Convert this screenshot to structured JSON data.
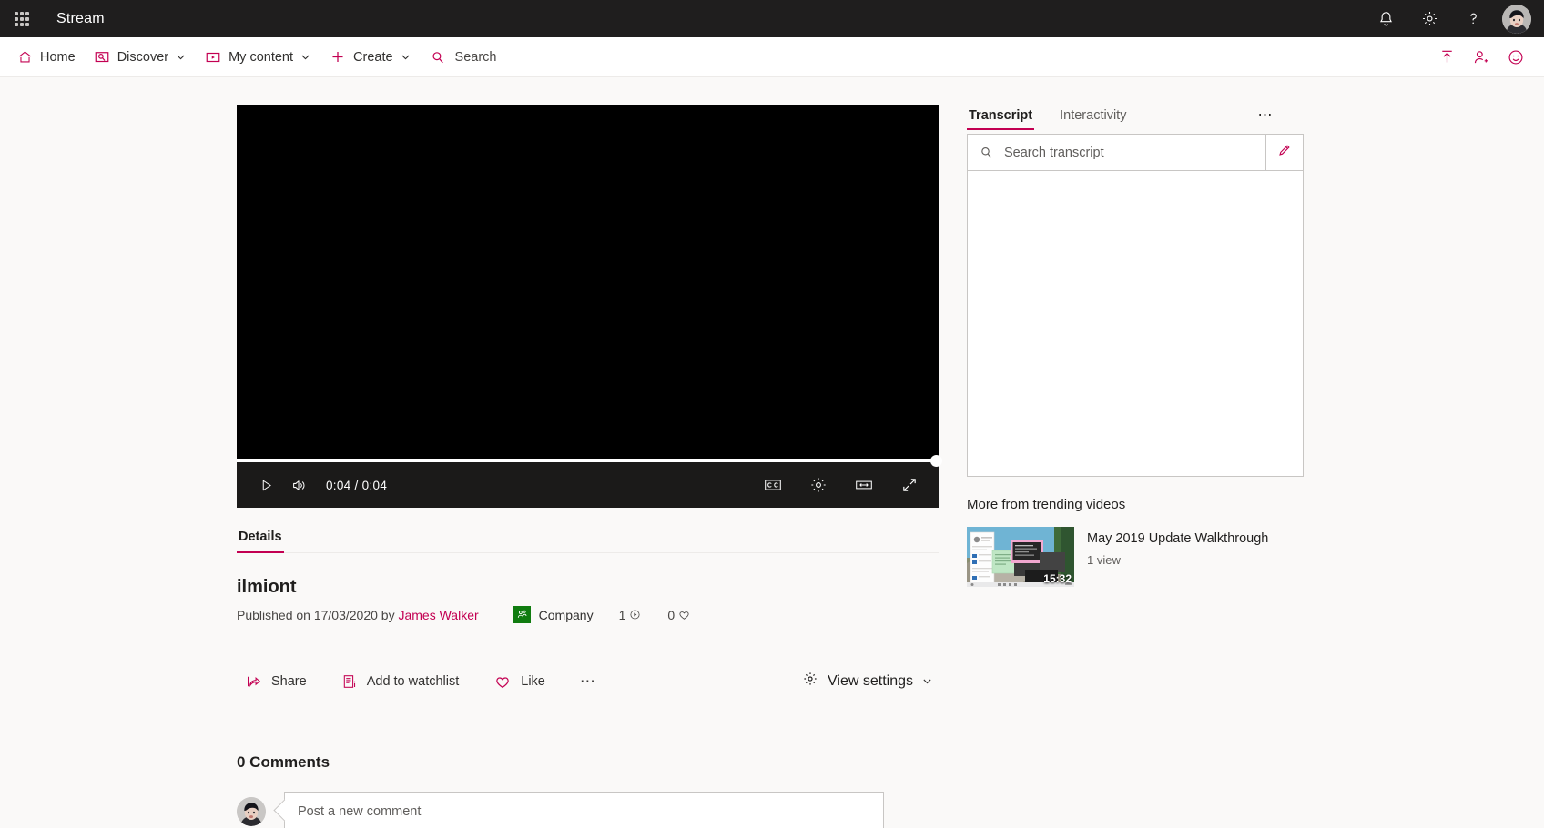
{
  "suitebar": {
    "app_title": "Stream",
    "waffle_icon": "app-launcher-icon",
    "icons": [
      "notifications-bell-icon",
      "settings-gear-icon",
      "help-question-icon"
    ],
    "avatar_label": "user-avatar"
  },
  "navbar": {
    "items": [
      {
        "label": "Home",
        "icon": "home-icon",
        "has_chevron": false
      },
      {
        "label": "Discover",
        "icon": "discover-icon",
        "has_chevron": true
      },
      {
        "label": "My content",
        "icon": "my-content-icon",
        "has_chevron": true
      },
      {
        "label": "Create",
        "icon": "plus-icon",
        "has_chevron": true
      }
    ],
    "search_placeholder": "Search",
    "search_icon": "search-icon",
    "right_icons": [
      "upload-icon",
      "add-person-icon",
      "feedback-smiley-icon"
    ]
  },
  "player": {
    "play_icon": "play-icon",
    "volume_icon": "volume-icon",
    "current_time": "0:04",
    "separator": "/",
    "duration": "0:04",
    "progress_percent": 100,
    "right_icons": [
      "closed-captions-icon",
      "player-settings-gear-icon",
      "mini-player-icon",
      "fullscreen-icon"
    ]
  },
  "details": {
    "tabs": [
      {
        "label": "Details",
        "active": true
      }
    ],
    "title": "ilmiont",
    "published_prefix": "Published on 17/03/2020 by",
    "author": "James Walker",
    "company_label": "Company",
    "company_color": "#107c10",
    "views_count": "1",
    "likes_count": "0",
    "actions": [
      {
        "label": "Share",
        "icon": "share-icon"
      },
      {
        "label": "Add to watchlist",
        "icon": "watchlist-icon"
      },
      {
        "label": "Like",
        "icon": "heart-icon"
      }
    ],
    "more_actions_icon": "more-ellipsis-icon",
    "view_settings_label": "View settings",
    "view_settings_icon": "gear-icon"
  },
  "comments": {
    "heading": "0 Comments",
    "placeholder": "Post a new comment",
    "avatar_label": "commenter-avatar"
  },
  "panel": {
    "tabs": [
      {
        "label": "Transcript",
        "active": true
      },
      {
        "label": "Interactivity",
        "active": false
      }
    ],
    "more_icon": "more-ellipsis-icon",
    "search_placeholder": "Search transcript",
    "search_icon": "search-icon",
    "edit_icon": "edit-pencil-icon",
    "trending_heading": "More from trending videos",
    "trending": [
      {
        "title": "May 2019 Update Walkthrough",
        "views": "1 view",
        "duration": "15:32"
      }
    ]
  },
  "theme": {
    "accent": "#c30052",
    "suitebar_bg": "#1f1e1e",
    "page_bg": "#faf9f8"
  }
}
